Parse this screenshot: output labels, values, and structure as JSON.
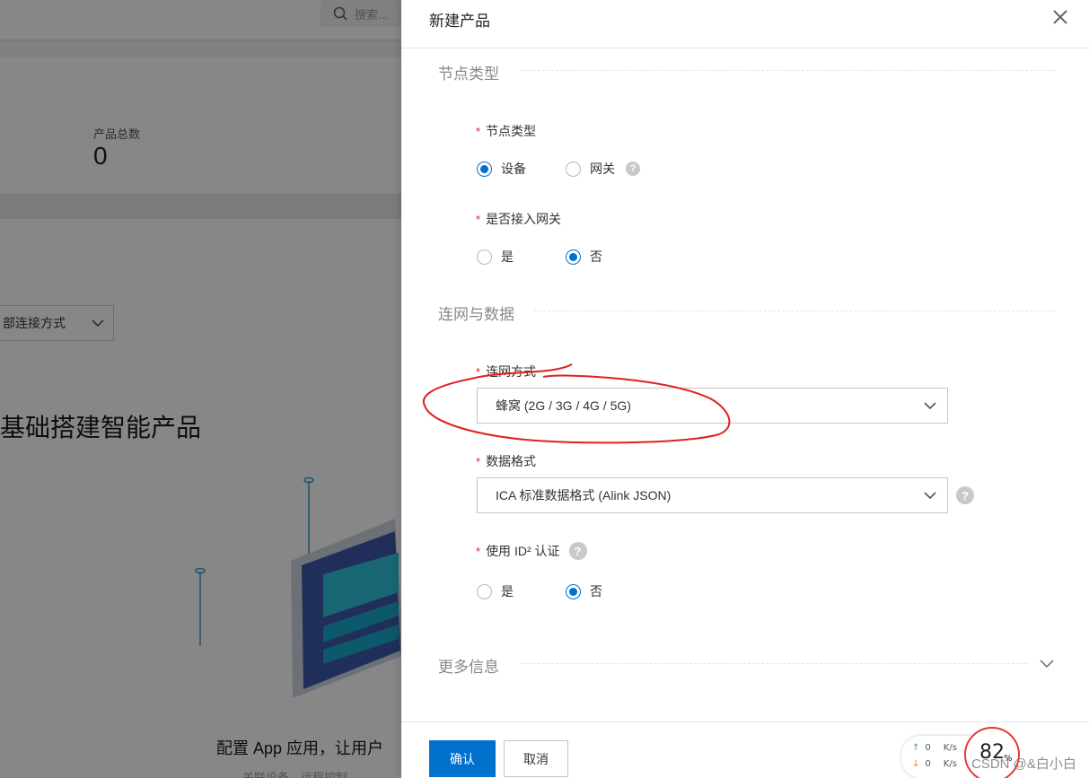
{
  "background": {
    "search_placeholder": "搜索...",
    "stat_label": "产品总数",
    "stat_value": "0",
    "filter_select": "部连接方式",
    "heading": "基础搭建智能产品",
    "caption": "配置 App 应用，让用户",
    "caption2": "关联设备，远程控制"
  },
  "drawer": {
    "title": "新建产品",
    "sections": {
      "node_type": "节点类型",
      "network": "连网与数据",
      "more": "更多信息"
    },
    "node_type": {
      "label": "节点类型",
      "options": [
        "设备",
        "网关"
      ],
      "selected": "设备"
    },
    "gateway": {
      "label": "是否接入网关",
      "options": [
        "是",
        "否"
      ],
      "selected": "否"
    },
    "network_mode": {
      "label": "连网方式",
      "value": "蜂窝 (2G / 3G / 4G / 5G)"
    },
    "data_format": {
      "label": "数据格式",
      "value": "ICA 标准数据格式 (Alink JSON)"
    },
    "id2": {
      "label": "使用 ID² 认证",
      "options": [
        "是",
        "否"
      ],
      "selected": "否"
    },
    "footer": {
      "confirm": "确认",
      "cancel": "取消"
    }
  },
  "required_mark": "*",
  "help_mark": "?",
  "speed_widget": {
    "upload_value": "0",
    "download_value": "0",
    "unit": "K/s",
    "gauge": "82",
    "gauge_unit": "%"
  },
  "watermark": "CSDN @&白小白",
  "colors": {
    "primary": "#0070cc",
    "required": "#e02020",
    "annotation": "#e02020"
  }
}
